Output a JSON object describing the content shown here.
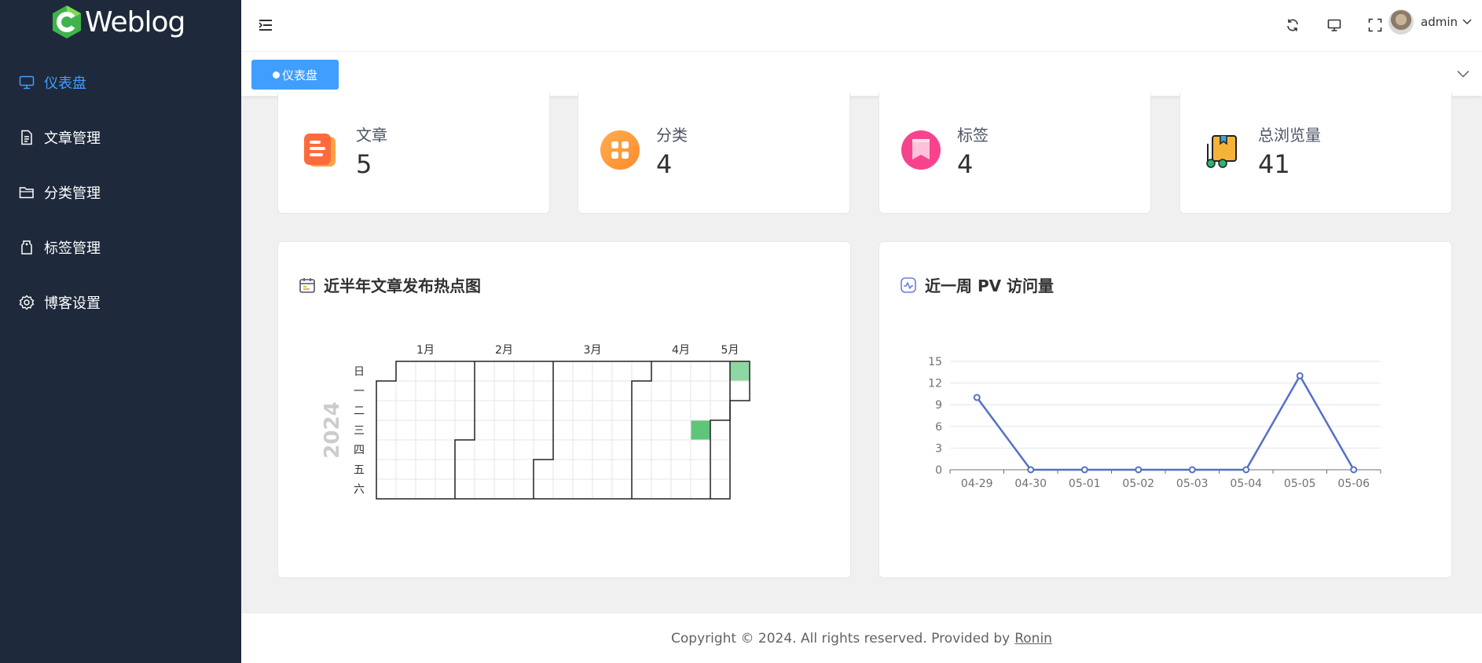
{
  "app": {
    "logo_text": "Weblog"
  },
  "sidebar": {
    "items": [
      {
        "label": "仪表盘",
        "icon": "monitor-icon",
        "active": true
      },
      {
        "label": "文章管理",
        "icon": "document-icon"
      },
      {
        "label": "分类管理",
        "icon": "folder-icon"
      },
      {
        "label": "标签管理",
        "icon": "tag-icon"
      },
      {
        "label": "博客设置",
        "icon": "gear-icon"
      }
    ]
  },
  "header": {
    "icons": [
      "menu-fold-icon",
      "refresh-icon",
      "monitor-icon",
      "fullscreen-icon"
    ],
    "username": "admin"
  },
  "tabs": [
    {
      "label": "仪表盘"
    }
  ],
  "stats": [
    {
      "label": "文章",
      "value": "5",
      "icon": "article-icon",
      "color": "#ff7043"
    },
    {
      "label": "分类",
      "value": "4",
      "icon": "category-icon",
      "color": "#ffa14a"
    },
    {
      "label": "标签",
      "value": "4",
      "icon": "tag-icon",
      "color": "#f7438d"
    },
    {
      "label": "总浏览量",
      "value": "41",
      "icon": "views-icon",
      "color": "#f6b33a"
    }
  ],
  "heatmap": {
    "title": "近半年文章发布热点图",
    "year": "2024",
    "months": [
      "1月",
      "2月",
      "3月",
      "4月",
      "5月"
    ],
    "weekdays": [
      "日",
      "一",
      "二",
      "三",
      "四",
      "五",
      "六"
    ],
    "active_dates": [
      "2024-04-24",
      "2024-05-05"
    ],
    "colors": {
      "active": "#5ec57a",
      "active_light": "#8fd7a2",
      "empty": "#ffffff",
      "grid": "#e5e5e5",
      "border": "#222222"
    }
  },
  "pv": {
    "title": "近一周 PV 访问量",
    "chart_data": {
      "type": "line",
      "categories": [
        "04-29",
        "04-30",
        "05-01",
        "05-02",
        "05-03",
        "05-04",
        "05-05",
        "05-06"
      ],
      "series": [
        {
          "values": [
            10,
            0,
            0,
            0,
            0,
            0,
            13,
            0
          ]
        }
      ],
      "ylim": [
        0,
        15
      ],
      "yticks": [
        0,
        3,
        6,
        9,
        12,
        15
      ],
      "color": "#5470c6"
    }
  },
  "footer": {
    "text": "Copyright © 2024. All rights reserved. Provided by",
    "link": "Ronin"
  }
}
